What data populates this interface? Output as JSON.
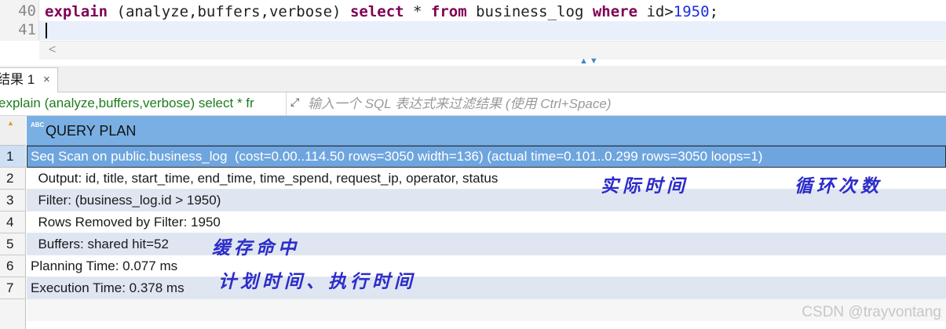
{
  "editor": {
    "line1_no": "40",
    "line2_no": "41",
    "tokens": {
      "kw_explain": "explain",
      "args": " (analyze,buffers,verbose) ",
      "kw_select": "select",
      "star": " * ",
      "kw_from": "from",
      "table": " business_log ",
      "kw_where": "where",
      "cond": " id>",
      "value": "1950",
      "semicolon": ";"
    },
    "scroll_left_glyph": "<",
    "splitter_glyph": "▲▼"
  },
  "results": {
    "tab_label": "结果 1",
    "tab_close_glyph": "×",
    "query_text": "explain (analyze,buffers,verbose) select * fr",
    "filter_icon_glyph": "⤢",
    "filter_placeholder": "输入一个 SQL 表达式来过滤结果 (使用 Ctrl+Space)"
  },
  "grid": {
    "type_icon": "ABC",
    "column_header": "QUERY PLAN",
    "rows": [
      {
        "num": "1",
        "text": "Seq Scan on public.business_log  (cost=0.00..114.50 rows=3050 width=136) (actual time=0.101..0.299 rows=3050 loops=1)"
      },
      {
        "num": "2",
        "text": "  Output: id, title, start_time, end_time, time_spend, request_ip, operator, status"
      },
      {
        "num": "3",
        "text": "  Filter: (business_log.id > 1950)"
      },
      {
        "num": "4",
        "text": "  Rows Removed by Filter: 1950"
      },
      {
        "num": "5",
        "text": "  Buffers: shared hit=52"
      },
      {
        "num": "6",
        "text": "Planning Time: 0.077 ms"
      },
      {
        "num": "7",
        "text": "Execution Time: 0.378 ms"
      }
    ],
    "selected_row": 1
  },
  "annotations": {
    "actual_time": "实际时间",
    "loops": "循环次数",
    "buffer_hit": "缓存命中",
    "planning_execution": "计划时间、执行时间"
  },
  "watermark": "CSDN @trayvontang",
  "colors": {
    "header_blue": "#79afe2",
    "selected_row": "#6ea5df",
    "alt_row": "#dfe6f1",
    "keyword": "#7f0055",
    "number": "#1c2de0",
    "annotation": "#2c2cc9",
    "query_green": "#1e7d1e"
  }
}
